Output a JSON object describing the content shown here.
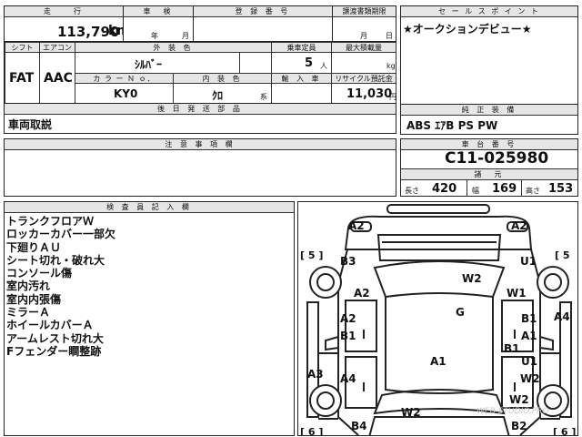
{
  "top_row": {
    "mileage_header": "走　　行",
    "inspection_header": "車　検",
    "registration_header": "登 録 番 号",
    "transfer_deadline_header": "譲渡書類期限",
    "mileage_value": "113,790",
    "mileage_unit": "km",
    "year_label": "年",
    "month_label": "月",
    "deadline_month_label": "月",
    "deadline_day_label": "日"
  },
  "spec_row": {
    "shift_header": "シフト",
    "aircon_header": "エアコン",
    "shift_value": "FAT",
    "aircon_value": "AAC",
    "exterior_color_header": "外 装 色",
    "exterior_color_value": "ｼﾙﾊﾞｰ",
    "capacity_header": "乗車定員",
    "capacity_value": "5",
    "capacity_unit": "人",
    "max_load_header": "最大積載量",
    "max_load_unit": "kg",
    "color_no_header": "カ ラ ー Ｎ ｏ．",
    "color_no_value": "KY0",
    "interior_color_header": "内 装 色",
    "interior_color_value": "ｸﾛ",
    "interior_suffix": "系",
    "import_header": "輸 入 車",
    "recycle_header": "リサイクル預託金",
    "recycle_value": "11,030",
    "recycle_unit": "円"
  },
  "docs": {
    "header": "後 日 発 送 部 品",
    "value": "車両取説"
  },
  "sales_point": {
    "header": "セ ー ル ス ポ イ ン ト",
    "value": "★オークションデビュー★"
  },
  "equipment": {
    "header": "純 正 装 備",
    "value": "ABS ｴｱB PS PW"
  },
  "notes": {
    "header": "注 意 事 項 欄"
  },
  "chassis": {
    "header": "車 台 番 号",
    "value": "C11-025980",
    "dims_header": "諸　元",
    "length_label": "長さ",
    "length_value": "420",
    "width_label": "幅",
    "width_value": "169",
    "height_label": "高さ",
    "height_value": "153"
  },
  "inspector": {
    "header": "検 査 員 記 入 欄",
    "lines": [
      "トランクフロアＷ",
      "ロッカーカバー一部欠",
      "下廻りＡＵ",
      "シート切れ・破れ大",
      "コンソール傷",
      "室内汚れ",
      "室内内張傷",
      "ミラーＡ",
      "ホイールカバーＡ",
      "アームレスト切れ大",
      "Fフェンダー瞷整跡"
    ]
  },
  "diagram": {
    "marks": {
      "a2_rear_left": "A2",
      "a2_rear_right": "A2",
      "b3": "B3",
      "u1_top": "U1",
      "w2_trunk": "W2",
      "w1": "W1",
      "a2_left_mid": "A2",
      "g": "G",
      "a2_left_door": "A2",
      "b1_left_door": "B1",
      "b1_right_a": "B1",
      "a1_right": "A1",
      "a4_right": "A4",
      "b1_right_b": "B1",
      "a1_center": "A1",
      "u1_right_low": "U1",
      "a3_left": "A3",
      "a4_left": "A4",
      "w2_right_low": "W2",
      "w2_hood": "W2",
      "w2_right_bottom": "W2",
      "b4": "B4",
      "b2": "B2"
    },
    "brackets": {
      "rear_left": "[ 5 ]",
      "rear_right": "[ 5",
      "front_left": "[ 6 ]",
      "front_right": "[ 6 ]"
    }
  },
  "watermark": "WEB-STUDIO.PRO"
}
